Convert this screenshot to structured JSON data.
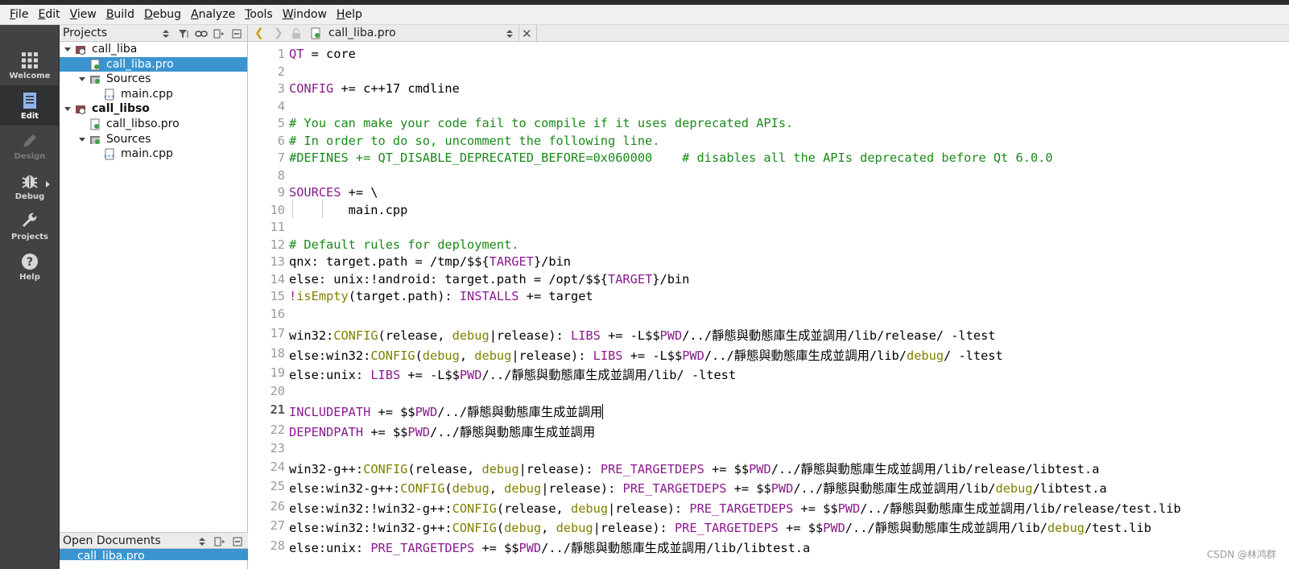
{
  "menu": [
    "File",
    "Edit",
    "View",
    "Build",
    "Debug",
    "Analyze",
    "Tools",
    "Window",
    "Help"
  ],
  "menu_mnemonic": [
    "F",
    "E",
    "V",
    "B",
    "D",
    "A",
    "T",
    "W",
    "H"
  ],
  "modes": [
    {
      "label": "Welcome",
      "icon": "grid-icon",
      "state": "normal"
    },
    {
      "label": "Edit",
      "icon": "document-icon",
      "state": "active"
    },
    {
      "label": "Design",
      "icon": "pencil-icon",
      "state": "disabled"
    },
    {
      "label": "Debug",
      "icon": "bug-icon",
      "state": "normal"
    },
    {
      "label": "Projects",
      "icon": "wrench-icon",
      "state": "normal"
    },
    {
      "label": "Help",
      "icon": "help-icon",
      "state": "normal"
    }
  ],
  "projects_panel": {
    "title": "Projects"
  },
  "tree": [
    {
      "label": "call_liba",
      "type": "project",
      "bold": false,
      "selected": false
    },
    {
      "label": "call_liba.pro",
      "type": "pro-file",
      "selected": true
    },
    {
      "label": "Sources",
      "type": "folder",
      "selected": false
    },
    {
      "label": "main.cpp",
      "type": "cpp-file",
      "selected": false
    },
    {
      "label": "call_libso",
      "type": "project",
      "bold": true,
      "selected": false
    },
    {
      "label": "call_libso.pro",
      "type": "pro-file",
      "selected": false
    },
    {
      "label": "Sources",
      "type": "folder",
      "selected": false
    },
    {
      "label": "main.cpp",
      "type": "cpp-file",
      "selected": false
    }
  ],
  "open_documents": {
    "title": "Open Documents",
    "items": [
      "call_liba.pro"
    ]
  },
  "editor": {
    "filename": "call_liba.pro",
    "current_line": "21",
    "line_numbers": [
      "1",
      "2",
      "3",
      "4",
      "5",
      "6",
      "7",
      "8",
      "9",
      "10",
      "11",
      "12",
      "13",
      "14",
      "15",
      "16",
      "17",
      "18",
      "19",
      "20",
      "21",
      "22",
      "23",
      "24",
      "25",
      "26",
      "27",
      "28"
    ]
  },
  "code": {
    "l1a": "QT",
    "l1b": " = core",
    "l3a": "CONFIG",
    "l3b": " += c++17 cmdline",
    "l5": "# You can make your code fail to compile if it uses deprecated APIs.",
    "l6": "# In order to do so, uncomment the following line.",
    "l7": "#DEFINES += QT_DISABLE_DEPRECATED_BEFORE=0x060000    # disables all the APIs deprecated before Qt 6.0.0",
    "l9a": "SOURCES",
    "l9b": " += \\",
    "l10": "        main.cpp",
    "l12": "# Default rules for deployment.",
    "l13a": "qnx: target.path = /tmp/$${",
    "l13b": "TARGET",
    "l13c": "}/bin",
    "l14a": "else: unix:!android: target.path = /opt/$${",
    "l14b": "TARGET",
    "l14c": "}/bin",
    "l15a": "!",
    "l15b": "isEmpty",
    "l15c": "(target.path): ",
    "l15d": "INSTALLS",
    "l15e": " += target",
    "l17a": "win32:",
    "l17b": "CONFIG",
    "l17c": "(release, ",
    "l17d": "debug",
    "l17e": "|release): ",
    "l17f": "LIBS",
    "l17g": " += -L$$",
    "l17h": "PWD",
    "l17i": "/../靜態與動態庫生成並調用/lib/release/ -ltest",
    "l18a": "else:win32:",
    "l18b": "CONFIG",
    "l18c": "(",
    "l18d": "debug",
    "l18e": ", ",
    "l18f": "debug",
    "l18g": "|release): ",
    "l18h": "LIBS",
    "l18i": " += -L$$",
    "l18j": "PWD",
    "l18k": "/../靜態與動態庫生成並調用/lib/",
    "l18l": "debug",
    "l18m": "/ -ltest",
    "l19a": "else:unix: ",
    "l19b": "LIBS",
    "l19c": " += -L$$",
    "l19d": "PWD",
    "l19e": "/../靜態與動態庫生成並調用/lib/ -ltest",
    "l21a": "INCLUDEPATH",
    "l21b": " += $$",
    "l21c": "PWD",
    "l21d": "/../靜態與動態庫生成並調用",
    "l22a": "DEPENDPATH",
    "l22b": " += $$",
    "l22c": "PWD",
    "l22d": "/../靜態與動態庫生成並調用",
    "l24a": "win32-g++:",
    "l24b": "CONFIG",
    "l24c": "(release, ",
    "l24d": "debug",
    "l24e": "|release): ",
    "l24f": "PRE_TARGETDEPS",
    "l24g": " += $$",
    "l24h": "PWD",
    "l24i": "/../靜態與動態庫生成並調用/lib/release/libtest.a",
    "l25a": "else:win32-g++:",
    "l25b": "CONFIG",
    "l25c": "(",
    "l25d": "debug",
    "l25e": ", ",
    "l25f": "debug",
    "l25g": "|release): ",
    "l25h": "PRE_TARGETDEPS",
    "l25i": " += $$",
    "l25j": "PWD",
    "l25k": "/../靜態與動態庫生成並調用/lib/",
    "l25l": "debug",
    "l25m": "/libtest.a",
    "l26a": "else:win32:!win32-g++:",
    "l26b": "CONFIG",
    "l26c": "(release, ",
    "l26d": "debug",
    "l26e": "|release): ",
    "l26f": "PRE_TARGETDEPS",
    "l26g": " += $$",
    "l26h": "PWD",
    "l26i": "/../靜態與動態庫生成並調用/lib/release/test.lib",
    "l27a": "else:win32:!win32-g++:",
    "l27b": "CONFIG",
    "l27c": "(",
    "l27d": "debug",
    "l27e": ", ",
    "l27f": "debug",
    "l27g": "|release): ",
    "l27h": "PRE_TARGETDEPS",
    "l27i": " += $$",
    "l27j": "PWD",
    "l27k": "/../靜態與動態庫生成並調用/lib/",
    "l27l": "debug",
    "l27m": "/test.lib",
    "l28a": "else:unix: ",
    "l28b": "PRE_TARGETDEPS",
    "l28c": " += $$",
    "l28d": "PWD",
    "l28e": "/../靜態與動態庫生成並調用/lib/libtest.a"
  },
  "watermark": "CSDN @林鸿群",
  "colors": {
    "keyword": "#8a1a8d",
    "comment": "#1a8a1a",
    "builtin": "#808000",
    "selection": "#3a94d0",
    "modebar": "#404244"
  }
}
